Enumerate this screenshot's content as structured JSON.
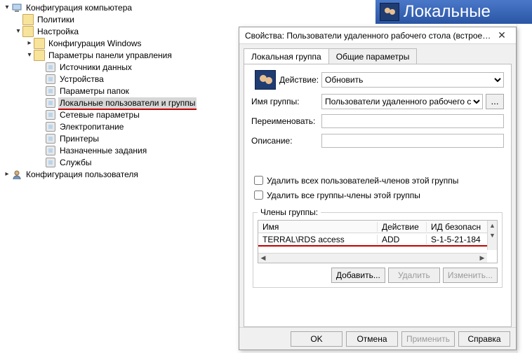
{
  "banner": {
    "title": "Локальные"
  },
  "tree": {
    "items": [
      {
        "depth": 0,
        "twisty": "down",
        "icon": "computer",
        "label": "Конфигурация компьютера"
      },
      {
        "depth": 1,
        "twisty": "none",
        "icon": "folder",
        "label": "Политики"
      },
      {
        "depth": 1,
        "twisty": "down",
        "icon": "folder",
        "label": "Настройка"
      },
      {
        "depth": 2,
        "twisty": "right",
        "icon": "folder",
        "label": "Конфигурация Windows"
      },
      {
        "depth": 2,
        "twisty": "down",
        "icon": "folder",
        "label": "Параметры панели управления"
      },
      {
        "depth": 3,
        "twisty": "none",
        "icon": "node",
        "label": "Источники данных"
      },
      {
        "depth": 3,
        "twisty": "none",
        "icon": "node",
        "label": "Устройства"
      },
      {
        "depth": 3,
        "twisty": "none",
        "icon": "node",
        "label": "Параметры папок"
      },
      {
        "depth": 3,
        "twisty": "none",
        "icon": "node",
        "label": "Локальные пользователи и группы",
        "selected": true,
        "red": true
      },
      {
        "depth": 3,
        "twisty": "none",
        "icon": "node",
        "label": "Сетевые параметры"
      },
      {
        "depth": 3,
        "twisty": "none",
        "icon": "node",
        "label": "Электропитание"
      },
      {
        "depth": 3,
        "twisty": "none",
        "icon": "node",
        "label": "Принтеры"
      },
      {
        "depth": 3,
        "twisty": "none",
        "icon": "node",
        "label": "Назначенные задания"
      },
      {
        "depth": 3,
        "twisty": "none",
        "icon": "node",
        "label": "Службы"
      },
      {
        "depth": 0,
        "twisty": "right",
        "icon": "user",
        "label": "Конфигурация пользователя"
      }
    ]
  },
  "dialog": {
    "title": "Свойства: Пользователи удаленного рабочего стола (встроен…",
    "tabs": {
      "local_group": "Локальная группа",
      "common": "Общие параметры"
    },
    "action_label": "Действие:",
    "action_value": "Обновить",
    "group_name_label": "Имя группы:",
    "group_name_value": "Пользователи удаленного рабочего сто",
    "rename_label": "Переименовать:",
    "rename_value": "",
    "description_label": "Описание:",
    "description_value": "",
    "cb_delete_users": "Удалить всех пользователей-членов этой группы",
    "cb_delete_groups": "Удалить все группы-члены этой группы",
    "members_legend": "Члены группы:",
    "grid": {
      "head": {
        "name": "Имя",
        "action": "Действие",
        "sid": "ИД безопасн"
      },
      "rows": [
        {
          "name": "TERRAL\\RDS access",
          "action": "ADD",
          "sid": "S-1-5-21-184"
        }
      ]
    },
    "btn_add": "Добавить...",
    "btn_remove": "Удалить",
    "btn_change": "Изменить...",
    "footer": {
      "ok": "OK",
      "cancel": "Отмена",
      "apply": "Применить",
      "help": "Справка"
    },
    "ellipsis": "..."
  }
}
